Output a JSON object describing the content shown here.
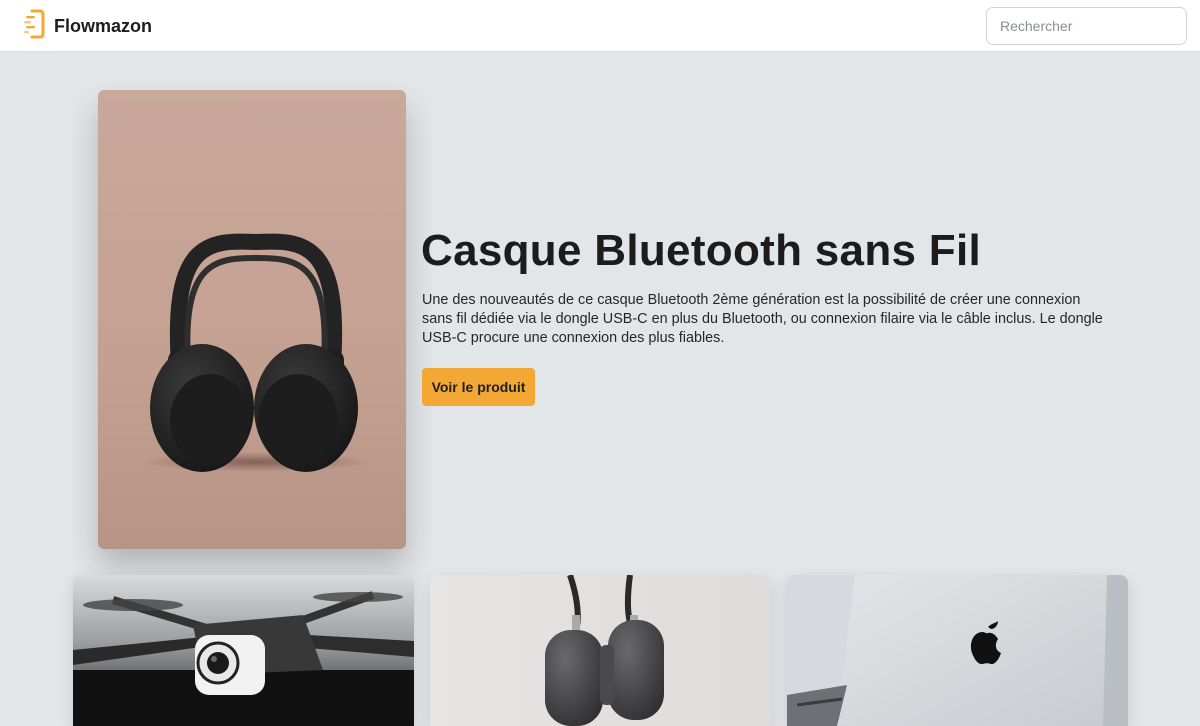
{
  "header": {
    "brand": "Flowmazon",
    "search_placeholder": "Rechercher"
  },
  "hero": {
    "title": "Casque Bluetooth sans Fil",
    "description": "Une des nouveautés de ce casque Bluetooth 2ème génération est la possibilité de créer une connexion sans fil dédiée via le dongle USB-C en plus du Bluetooth, ou connexion filaire via le câble inclus. Le dongle USB-C procure une connexion des plus fiables.",
    "cta_label": "Voir le produit"
  },
  "colors": {
    "accent": "#f3a836",
    "page_background": "#e3e6e9",
    "header_background": "#ffffff"
  },
  "products": [
    {
      "image": "drone-photo"
    },
    {
      "image": "headphones-photo"
    },
    {
      "image": "laptop-photo"
    }
  ]
}
